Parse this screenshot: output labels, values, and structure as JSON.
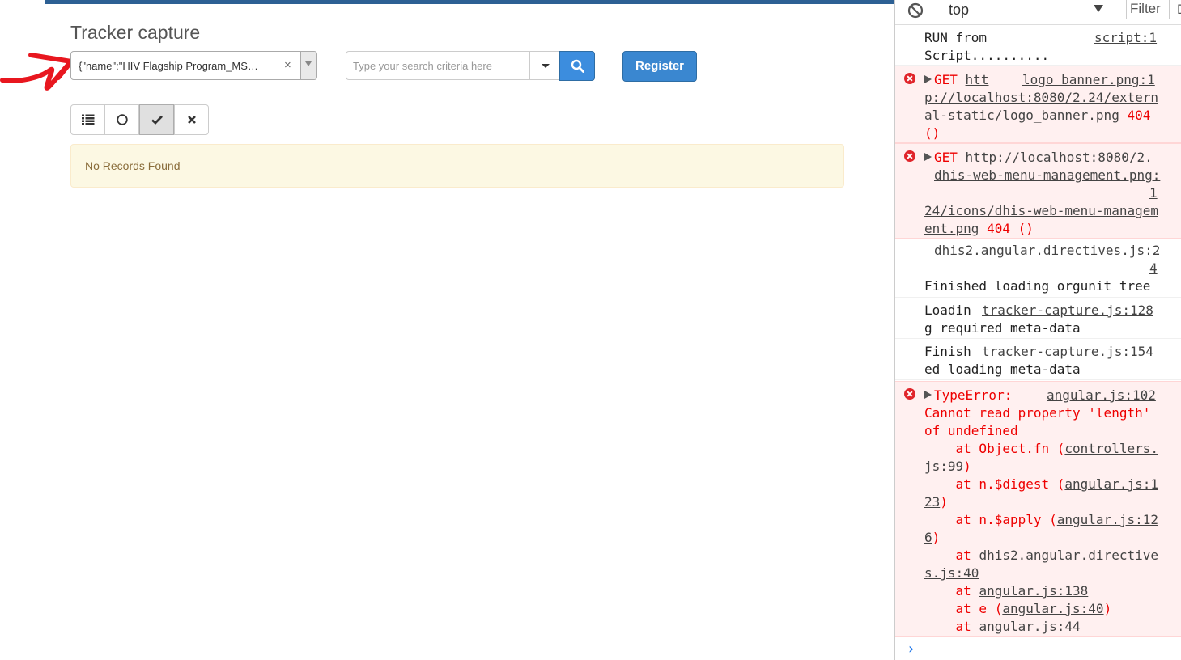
{
  "app": {
    "title": "Tracker capture",
    "program_select": {
      "value": "{\"name\":\"HIV Flagship Program_MS…",
      "clear_glyph": "×"
    },
    "search": {
      "placeholder": "Type your search criteria here"
    },
    "register_label": "Register",
    "view_buttons": [
      {
        "icon": "list-icon"
      },
      {
        "icon": "circle-icon"
      },
      {
        "icon": "check-icon",
        "active": true
      },
      {
        "icon": "times-icon"
      }
    ],
    "alert_text": "No Records Found",
    "colors": {
      "topbar": "#2d6094",
      "primary": "#3a87d0",
      "annotation_arrow": "#e8171f"
    }
  },
  "devtools": {
    "context": "top",
    "filter_label": "Filter",
    "edge_glyph": "D",
    "prompt_glyph": "›",
    "messages": [
      {
        "type": "log",
        "line1": "RUN from",
        "source": "script:1",
        "line2": "Script.........."
      },
      {
        "type": "error",
        "l1_method": "GET",
        "l1_url": "htt",
        "source": "logo_banner.png:1",
        "l2": "p://localhost:8080/2.24/extern",
        "l3_url": "al-static/logo_banner.png",
        "l3_status": "404",
        "l4": "()"
      },
      {
        "type": "error",
        "l1_method": "GET",
        "l1_url": "http://localhost:8080/2.",
        "l2": "dhis-web-menu-management.png:",
        "l3": "1",
        "l4": "24/icons/dhis-web-menu-managem",
        "l5_url": "ent.png",
        "l5_status": "404 ()"
      },
      {
        "type": "log",
        "source_a": "dhis2.angular.directives.js:2",
        "source_b": "4",
        "text": "Finished loading orgunit tree"
      },
      {
        "type": "log",
        "prefix": "Loadin",
        "source": "tracker-capture.js:128",
        "text": "g required meta-data"
      },
      {
        "type": "log",
        "prefix": "Finish",
        "source": "tracker-capture.js:154",
        "text": "ed loading meta-data"
      },
      {
        "type": "error",
        "head": "TypeError:",
        "source": "angular.js:102",
        "l2": "Cannot read property 'length'",
        "l3": "of undefined",
        "stack": [
          {
            "pre": "    at Object.fn (",
            "link": "controllers.",
            "post": ""
          },
          {
            "pre": "",
            "link": "js:99",
            "post": ")"
          },
          {
            "pre": "    at n.$digest (",
            "link": "angular.js:1",
            "post": ""
          },
          {
            "pre": "",
            "link": "23",
            "post": ")"
          },
          {
            "pre": "    at n.$apply (",
            "link": "angular.js:12",
            "post": ""
          },
          {
            "pre": "",
            "link": "6",
            "post": ")"
          },
          {
            "pre": "    at ",
            "link": "dhis2.angular.directive",
            "post": ""
          },
          {
            "pre": "",
            "link": "s.js:40",
            "post": ""
          },
          {
            "pre": "    at ",
            "link": "angular.js:138",
            "post": ""
          },
          {
            "pre": "    at e (",
            "link": "angular.js:40",
            "post": ")"
          },
          {
            "pre": "    at ",
            "link": "angular.js:44",
            "post": ""
          }
        ]
      }
    ]
  }
}
